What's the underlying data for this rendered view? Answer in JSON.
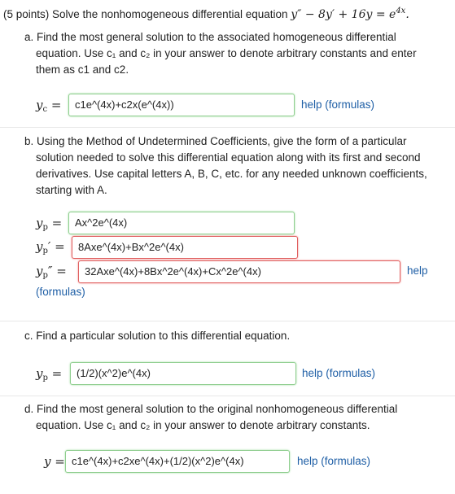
{
  "header": {
    "points": "(5 points) Solve the nonhomogeneous differential equation",
    "equation": [
      "y″ − 8y′ + 16y = e",
      "4x"
    ]
  },
  "part_a": {
    "lines": [
      "a. Find the most general solution to the associated homogeneous differential",
      "equation. Use c₁ and c₂ in your answer to denote arbitrary constants and enter",
      "them as c1 and c2."
    ],
    "label": "y",
    "label_sub": "c",
    "eq": "=",
    "value": "c1e^(4x)+c2x(e^(4x))",
    "help": "help (formulas)"
  },
  "part_b": {
    "lines": [
      "b. Using the Method of Undetermined Coefficients, give the form of a particular",
      "solution needed to solve this differential equation along with its first and second",
      "derivatives. Use capital letters A, B, C, etc. for any needed unknown coefficients,",
      "starting with A."
    ],
    "yp_label": "y",
    "yp_sub": "p",
    "yp_value": "Ax^2e^(4x)",
    "yp1_suffix": "′",
    "yp1_value": "8Axe^(4x)+Bx^2e^(4x)",
    "yp2_suffix": "″",
    "yp2_value": "32Axe^(4x)+8Bx^2e^(4x)+Cx^2e^(4x)",
    "eq": "=",
    "help1": "help",
    "help2": "(formulas)"
  },
  "part_c": {
    "line": "c. Find a particular solution to this differential equation.",
    "label": "y",
    "label_sub": "p",
    "eq": "=",
    "value": "(1/2)(x^2)e^(4x)",
    "help": "help (formulas)"
  },
  "part_d": {
    "lines": [
      "d. Find the most general solution to the original nonhomogeneous differential",
      "equation. Use c₁ and c₂ in your answer to denote arbitrary constants."
    ],
    "label": "y",
    "eq": "=",
    "value": "c1e^(4x)+c2xe^(4x)+(1/2)(x^2)e^(4x)",
    "help": "help (formulas)"
  }
}
